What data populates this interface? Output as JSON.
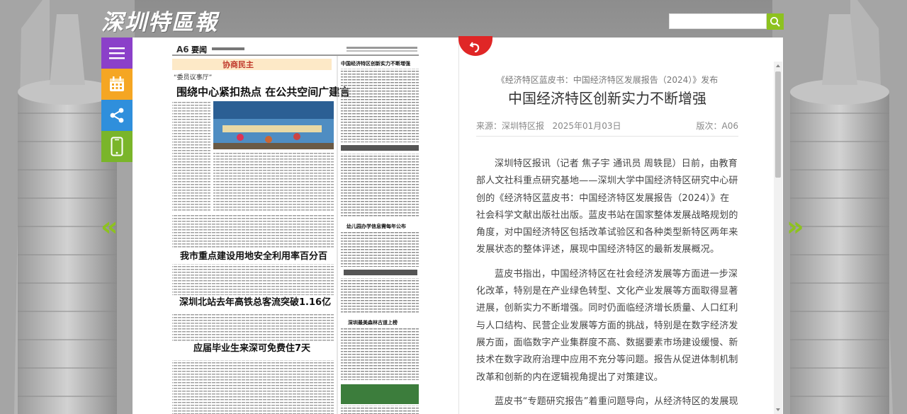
{
  "header": {
    "logo_text": "深圳特區報",
    "search": {
      "placeholder": "",
      "value": ""
    }
  },
  "toolbar": {
    "items": [
      {
        "name": "menu",
        "color": "#8b40c9"
      },
      {
        "name": "calendar",
        "color": "#f5a623"
      },
      {
        "name": "share",
        "color": "#2f8fdc"
      },
      {
        "name": "mobile",
        "color": "#7ab52a"
      }
    ]
  },
  "navigation": {
    "prev": "«",
    "next": "»"
  },
  "newspaper": {
    "page_label": "A6",
    "section": "要闻",
    "banner": "协商民主",
    "headlines": [
      "“委员议事厅”",
      "围绕中心紧扣热点 在公共空间广建言",
      "中国经济特区创新实力不断增强",
      "我市重点建设用地安全利用率百分百",
      "深圳北站去年高铁总客流突破1.16亿",
      "应届毕业生来深可免费住7天",
      "幼儿园办学信息需每年公布",
      "深圳最美森林古道上榜"
    ]
  },
  "article": {
    "subtitle": "《经济特区蓝皮书：中国经济特区发展报告（2024）》发布",
    "title": "中国经济特区创新实力不断增强",
    "source": "来源：深圳特区报",
    "date": "2025年01月03日",
    "edition": "版次：A06",
    "paragraphs": [
      "深圳特区报讯（记者 焦子宇 通讯员 周轶昆）日前，由教育部人文社科重点研究基地——深圳大学中国经济特区研究中心研创的《经济特区蓝皮书：中国经济特区发展报告（2024）》在社会科学文献出版社出版。蓝皮书站在国家整体发展战略规划的角度，对中国经济特区包括改革试验区和各种类型新特区两年来发展状态的整体评述，展现中国经济特区的最新发展概况。",
      "蓝皮书指出，中国经济特区在社会经济发展等方面进一步深化改革，特别是在产业绿色转型、文化产业发展等方面取得显著进展，创新实力不断增强。同时仍面临经济增长质量、人口红利与人口结构、民营企业发展等方面的挑战，特别是在数字经济发展方面，面临数字产业集群度不高、数据要素市场建设缓慢、新技术在数字政府治理中应用不充分等问题。报告从促进体制机制改革和创新的内在逻辑视角提出了对策建议。",
      "蓝皮书“专题研究报告”着重问题导向，从经济特区的发展现状、比较分析、政策建议为切入点，剖析其所面临的转型问"
    ]
  }
}
